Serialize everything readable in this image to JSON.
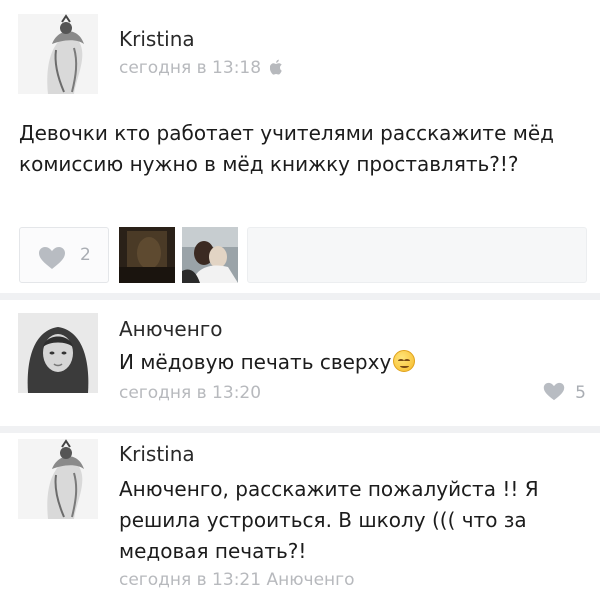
{
  "post": {
    "author": "Kristina",
    "time": "сегодня в 13:18",
    "device_icon": "apple-icon",
    "text": "Девочки кто работает учителями расскажите мёд комиссию нужно в мёд книжку проставлять?!?",
    "likes": "2",
    "photos": [
      "photo-thumbnail-dark",
      "photo-thumbnail-wedding"
    ]
  },
  "comments": [
    {
      "author": "Анюченго",
      "text": "И мёдовую печать сверху",
      "emoji": "smiling-face-emoji",
      "time": "сегодня в 13:20",
      "likes": "5"
    },
    {
      "author": "Kristina",
      "text": "Анюченго, расскажите пожалуйста !! Я решила устроиться. В школу ((( что за медовая печать?!",
      "time": "сегодня в 13:21",
      "reply_to": "Анюченго"
    }
  ],
  "colors": {
    "background": "#f0f1f3",
    "card": "#ffffff",
    "meta_text": "#b7b9bd",
    "icon": "#a9adb3"
  }
}
